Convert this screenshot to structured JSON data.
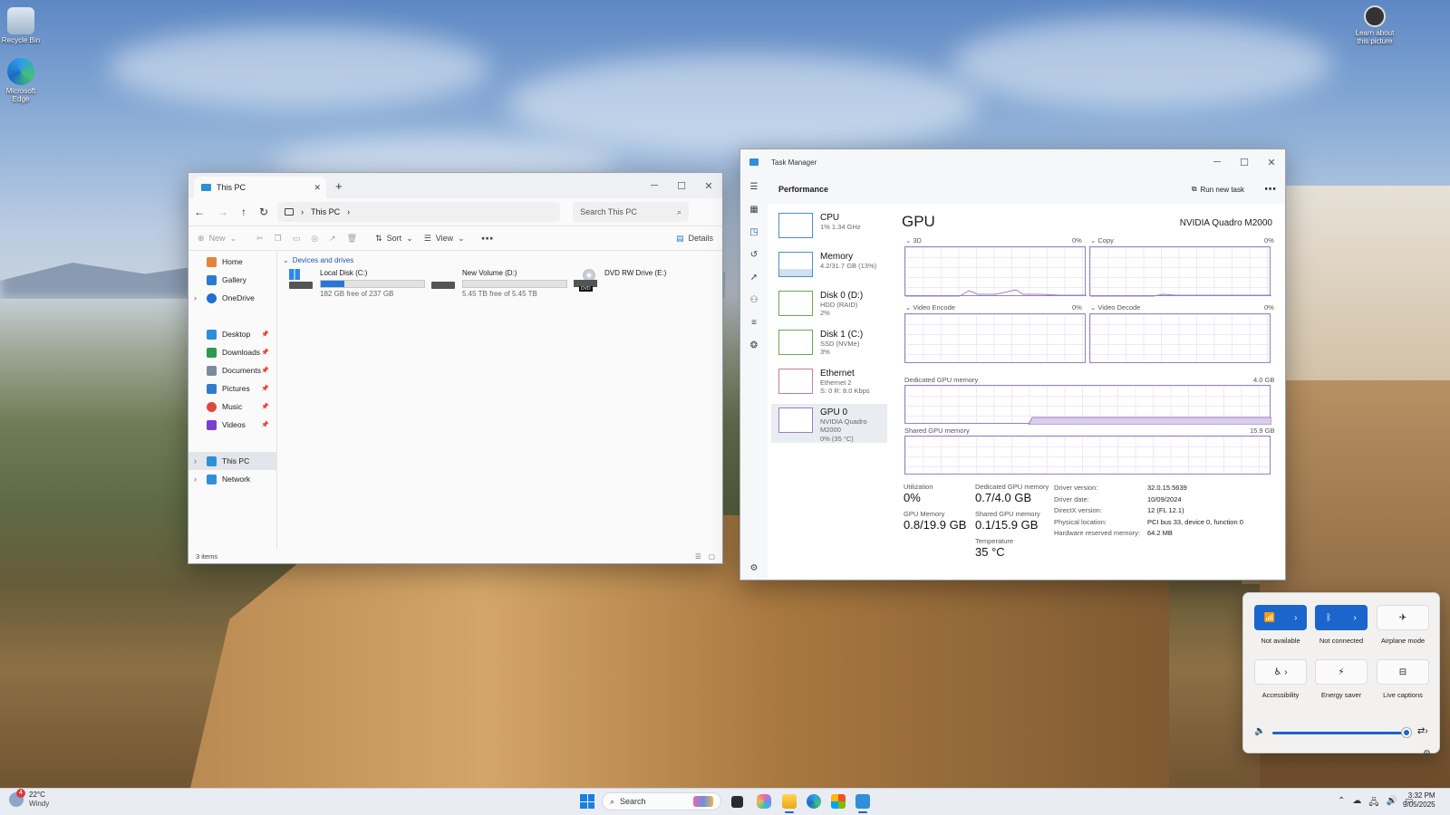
{
  "desktop": {
    "icons": [
      {
        "label": "Recycle Bin",
        "icon": "recycle-bin-icon"
      },
      {
        "label": "Microsoft Edge",
        "icon": "edge-icon"
      }
    ],
    "learn_label": "Learn about this picture"
  },
  "explorer": {
    "tab_title": "This PC",
    "breadcrumb": "This PC",
    "search_placeholder": "Search This PC",
    "toolbar": {
      "new": "New",
      "sort": "Sort",
      "view": "View",
      "details": "Details"
    },
    "nav": [
      {
        "label": "Home",
        "color": "#e8833a"
      },
      {
        "label": "Gallery",
        "color": "#2b7bd6"
      },
      {
        "label": "OneDrive",
        "color": "#1d6fd1"
      },
      {
        "label": "Desktop",
        "color": "#2e8ed8"
      },
      {
        "label": "Downloads",
        "color": "#2d9a54"
      },
      {
        "label": "Documents",
        "color": "#7a8d9e"
      },
      {
        "label": "Pictures",
        "color": "#2f7dd0"
      },
      {
        "label": "Music",
        "color": "#e0483b"
      },
      {
        "label": "Videos",
        "color": "#7b3fd1"
      },
      {
        "label": "This PC",
        "color": "#2f8fd9"
      },
      {
        "label": "Network",
        "color": "#2f8fd9"
      }
    ],
    "section": "Devices and drives",
    "drives": [
      {
        "name": "Local Disk (C:)",
        "free": "182 GB free of 237 GB",
        "used_fraction": 0.23
      },
      {
        "name": "New Volume (D:)",
        "free": "5.45 TB free of 5.45 TB",
        "used_fraction": 0.0
      },
      {
        "name": "DVD RW Drive (E:)",
        "free": "",
        "badge": "DVD"
      }
    ],
    "status": "3 items"
  },
  "taskmgr": {
    "title": "Task Manager",
    "section": "Performance",
    "run_task": "Run new task",
    "list": [
      {
        "name": "CPU",
        "sub": [
          "1% 1.34 GHz"
        ]
      },
      {
        "name": "Memory",
        "sub": [
          "4.2/31.7 GB (13%)"
        ]
      },
      {
        "name": "Disk 0 (D:)",
        "sub": [
          "HDD (RAID)",
          "2%"
        ]
      },
      {
        "name": "Disk 1 (C:)",
        "sub": [
          "SSD (NVMe)",
          "3%"
        ]
      },
      {
        "name": "Ethernet",
        "sub": [
          "Ethernet 2",
          "S: 0 R: 8.0 Kbps"
        ]
      },
      {
        "name": "GPU 0",
        "sub": [
          "NVIDIA Quadro M2000",
          "0% (35 °C)"
        ]
      }
    ],
    "gpu_title": "GPU",
    "gpu_model": "NVIDIA Quadro M2000",
    "engines": [
      {
        "label": "3D",
        "pct": "0%"
      },
      {
        "label": "Copy",
        "pct": "0%"
      },
      {
        "label": "Video Encode",
        "pct": "0%"
      },
      {
        "label": "Video Decode",
        "pct": "0%"
      }
    ],
    "dedicated_label": "Dedicated GPU memory",
    "dedicated_max": "4.0 GB",
    "shared_label": "Shared GPU memory",
    "shared_max": "15.9 GB",
    "stats": {
      "utilization_label": "Utilization",
      "utilization": "0%",
      "gpumem_label": "GPU Memory",
      "gpumem": "0.8/19.9 GB",
      "ded_label": "Dedicated GPU memory",
      "ded": "0.7/4.0 GB",
      "shr_label": "Shared GPU memory",
      "shr": "0.1/15.9 GB",
      "temp_label": "Temperature",
      "temp": "35 °C"
    },
    "info": [
      {
        "k": "Driver version:",
        "v": "32.0.15.5639"
      },
      {
        "k": "Driver date:",
        "v": "10/09/2024"
      },
      {
        "k": "DirectX version:",
        "v": "12 (FL 12.1)"
      },
      {
        "k": "Physical location:",
        "v": "PCI bus 33, device 0, function 0"
      },
      {
        "k": "Hardware reserved memory:",
        "v": "64.2 MB"
      }
    ]
  },
  "quick_settings": {
    "tiles": [
      {
        "label": "Not available",
        "icon": "wifi-icon",
        "active": true
      },
      {
        "label": "Not connected",
        "icon": "bluetooth-icon",
        "active": true
      },
      {
        "label": "Airplane mode",
        "icon": "airplane-icon",
        "active": false
      },
      {
        "label": "Accessibility",
        "icon": "accessibility-icon",
        "active": false
      },
      {
        "label": "Energy saver",
        "icon": "energy-saver-icon",
        "active": false
      },
      {
        "label": "Live captions",
        "icon": "captions-icon",
        "active": false
      }
    ],
    "volume_fraction": 0.98
  },
  "taskbar": {
    "weather_temp": "22°C",
    "weather_desc": "Windy",
    "weather_badge": "4",
    "search": "Search",
    "time": "3:32 PM",
    "date": "9/05/2025"
  }
}
